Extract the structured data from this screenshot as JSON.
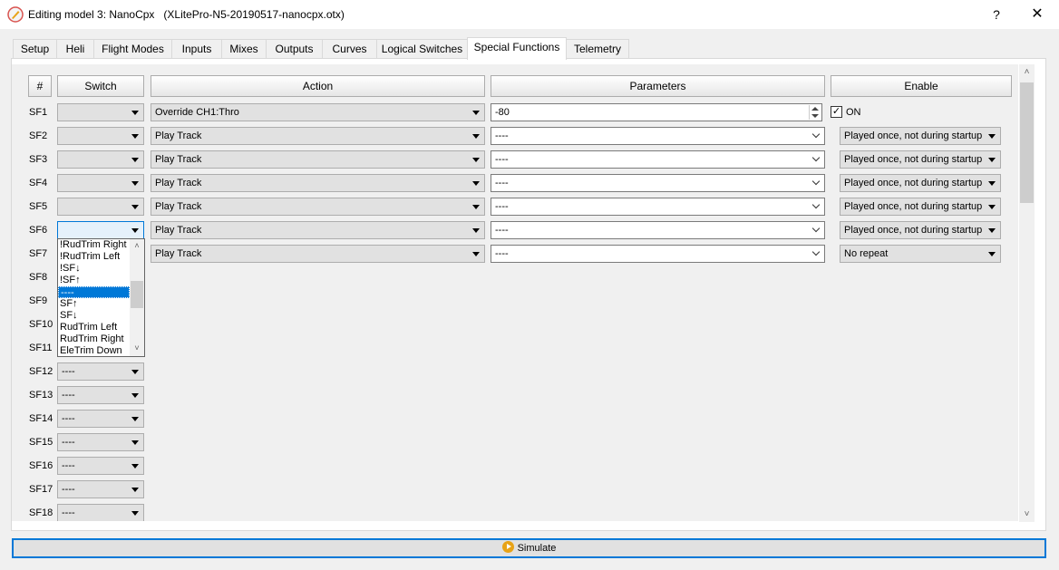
{
  "window": {
    "title": "Editing model 3: NanoCpx   (XLitePro-N5-20190517-nanocpx.otx)",
    "help": "?",
    "close": "✕"
  },
  "tabs": [
    "Setup",
    "Heli",
    "Flight Modes",
    "Inputs",
    "Mixes",
    "Outputs",
    "Curves",
    "Logical Switches",
    "Special Functions",
    "Telemetry"
  ],
  "active_tab": "Special Functions",
  "table": {
    "headers": {
      "num": "#",
      "switch": "Switch",
      "action": "Action",
      "parameters": "Parameters",
      "enable": "Enable"
    },
    "rows": [
      {
        "id": "SF1",
        "switch": "",
        "action": "Override CH1:Thro",
        "param": "-80",
        "enable_check": "✓",
        "enable_label": "ON"
      },
      {
        "id": "SF2",
        "switch": "",
        "action": "Play Track",
        "param": "----",
        "enable": "Played once, not during startup"
      },
      {
        "id": "SF3",
        "switch": "",
        "action": "Play Track",
        "param": "----",
        "enable": "Played once, not during startup"
      },
      {
        "id": "SF4",
        "switch": "",
        "action": "Play Track",
        "param": "----",
        "enable": "Played once, not during startup"
      },
      {
        "id": "SF5",
        "switch": "",
        "action": "Play Track",
        "param": "----",
        "enable": "Played once, not during startup"
      },
      {
        "id": "SF6",
        "switch": "",
        "action": "Play Track",
        "param": "----",
        "enable": "Played once, not during startup"
      },
      {
        "id": "SF7",
        "switch": "",
        "action": "Play Track",
        "param": "----",
        "enable": "No repeat"
      },
      {
        "id": "SF8",
        "switch": ""
      },
      {
        "id": "SF9",
        "switch": ""
      },
      {
        "id": "SF10",
        "switch": ""
      },
      {
        "id": "SF11",
        "switch": ""
      },
      {
        "id": "SF12",
        "switch": "----"
      },
      {
        "id": "SF13",
        "switch": "----"
      },
      {
        "id": "SF14",
        "switch": "----"
      },
      {
        "id": "SF15",
        "switch": "----"
      },
      {
        "id": "SF16",
        "switch": "----"
      },
      {
        "id": "SF17",
        "switch": "----"
      },
      {
        "id": "SF18",
        "switch": "----"
      }
    ]
  },
  "switch_dropdown": {
    "items": [
      "!RudTrim Right",
      "!RudTrim Left",
      "!SF↓",
      "!SF↑",
      "----",
      "SF↑",
      "SF↓",
      "RudTrim Left",
      "RudTrim Right",
      "EleTrim Down"
    ],
    "selected": "----"
  },
  "simulate_label": "Simulate"
}
